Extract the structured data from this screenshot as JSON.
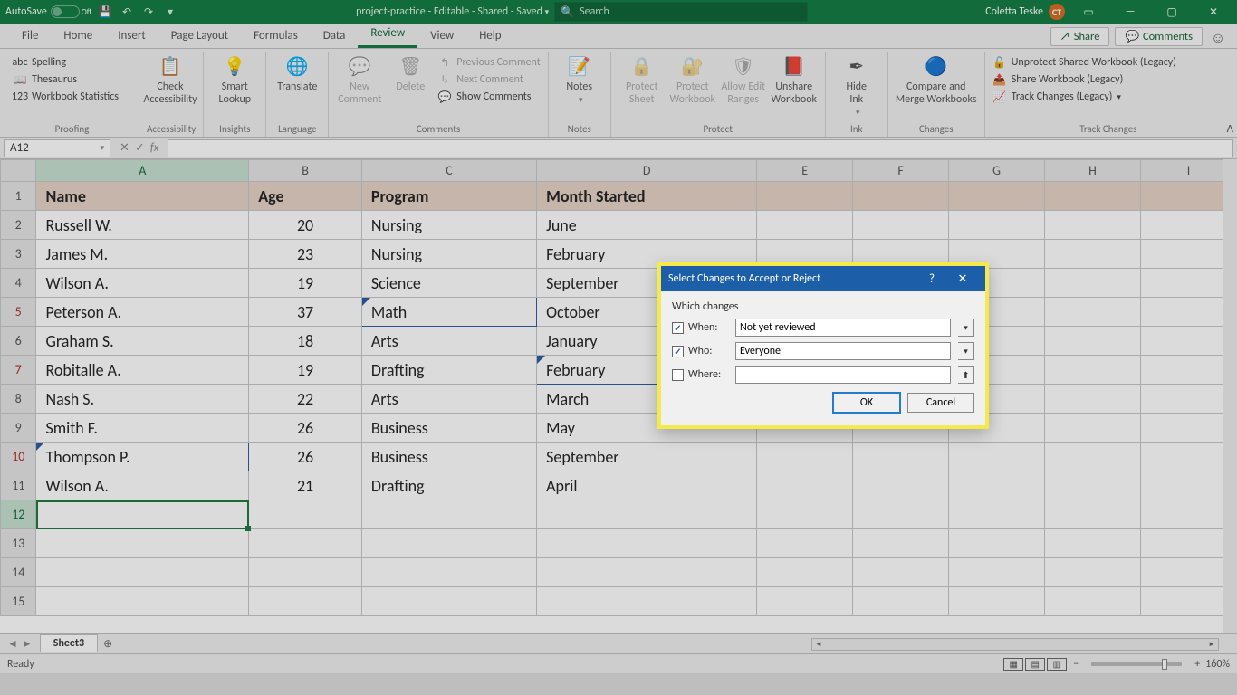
{
  "titlebar": {
    "autosave_label": "AutoSave",
    "autosave_state": "Off",
    "doc_name": "project-practice",
    "doc_suffix": " - Editable - Shared - Saved",
    "search_placeholder": "Search",
    "user_name": "Coletta Teske",
    "user_initials": "CT"
  },
  "ribbon": {
    "tabs": [
      "File",
      "Home",
      "Insert",
      "Page Layout",
      "Formulas",
      "Data",
      "Review",
      "View",
      "Help"
    ],
    "active_tab": "Review",
    "share": "Share",
    "comments": "Comments",
    "groups": {
      "proofing": {
        "label": "Proofing",
        "spelling": "Spelling",
        "thesaurus": "Thesaurus",
        "workbook_stats": "Workbook Statistics"
      },
      "accessibility": {
        "label": "Accessibility",
        "check": "Check\nAccessibility"
      },
      "insights": {
        "label": "Insights",
        "smart_lookup": "Smart\nLookup"
      },
      "language": {
        "label": "Language",
        "translate": "Translate"
      },
      "comments": {
        "label": "Comments",
        "new": "New\nComment",
        "delete": "Delete",
        "prev": "Previous Comment",
        "next": "Next Comment",
        "show": "Show Comments"
      },
      "notes": {
        "label": "Notes",
        "notes": "Notes"
      },
      "protect": {
        "label": "Protect",
        "sheet": "Protect\nSheet",
        "workbook": "Protect\nWorkbook",
        "ranges": "Allow Edit\nRanges",
        "unshare": "Unshare\nWorkbook"
      },
      "ink": {
        "label": "Ink",
        "hide": "Hide\nInk"
      },
      "changes": {
        "label": "Changes",
        "compare": "Compare and\nMerge Workbooks"
      },
      "track": {
        "label": "Track Changes",
        "unprotect": "Unprotect Shared Workbook (Legacy)",
        "share_wb": "Share Workbook (Legacy)",
        "track_changes": "Track Changes (Legacy)"
      }
    }
  },
  "formula_bar": {
    "name_box": "A12",
    "fx": "fx"
  },
  "grid": {
    "columns": [
      "A",
      "B",
      "C",
      "D",
      "E",
      "F",
      "G",
      "H",
      "I"
    ],
    "header": {
      "A": "Name",
      "B": "Age",
      "C": "Program",
      "D": "Month Started"
    },
    "rows": [
      {
        "n": "2",
        "A": "Russell W.",
        "B": "20",
        "C": "Nursing",
        "D": "June"
      },
      {
        "n": "3",
        "A": "James M.",
        "B": "23",
        "C": "Nursing",
        "D": "February"
      },
      {
        "n": "4",
        "A": "Wilson A.",
        "B": "19",
        "C": "Science",
        "D": "September"
      },
      {
        "n": "5",
        "A": "Peterson A.",
        "B": "37",
        "C": "Math",
        "D": "October",
        "track": true,
        "track_cell": "C"
      },
      {
        "n": "6",
        "A": "Graham S.",
        "B": "18",
        "C": "Arts",
        "D": "January"
      },
      {
        "n": "7",
        "A": "Robitalle A.",
        "B": "19",
        "C": "Drafting",
        "D": "February",
        "track": true,
        "track_cell": "D"
      },
      {
        "n": "8",
        "A": "Nash S.",
        "B": "22",
        "C": "Arts",
        "D": "March"
      },
      {
        "n": "9",
        "A": "Smith F.",
        "B": "26",
        "C": "Business",
        "D": "May"
      },
      {
        "n": "10",
        "A": "Thompson P.",
        "B": "26",
        "C": "Business",
        "D": "September",
        "track": true,
        "track_cell": "A"
      },
      {
        "n": "11",
        "A": "Wilson A.",
        "B": "21",
        "C": "Drafting",
        "D": "April"
      },
      {
        "n": "12",
        "A": "",
        "B": "",
        "C": "",
        "D": "",
        "active": true
      },
      {
        "n": "13",
        "A": "",
        "B": "",
        "C": "",
        "D": ""
      },
      {
        "n": "14",
        "A": "",
        "B": "",
        "C": "",
        "D": ""
      },
      {
        "n": "15",
        "A": "",
        "B": "",
        "C": "",
        "D": ""
      }
    ]
  },
  "sheet_tabs": {
    "active": "Sheet3"
  },
  "status": {
    "ready": "Ready",
    "zoom": "160%"
  },
  "dialog": {
    "title": "Select Changes to Accept or Reject",
    "section": "Which changes",
    "when_label": "When:",
    "when_value": "Not yet reviewed",
    "who_label": "Who:",
    "who_value": "Everyone",
    "where_label": "Where:",
    "where_value": "",
    "ok": "OK",
    "cancel": "Cancel"
  }
}
